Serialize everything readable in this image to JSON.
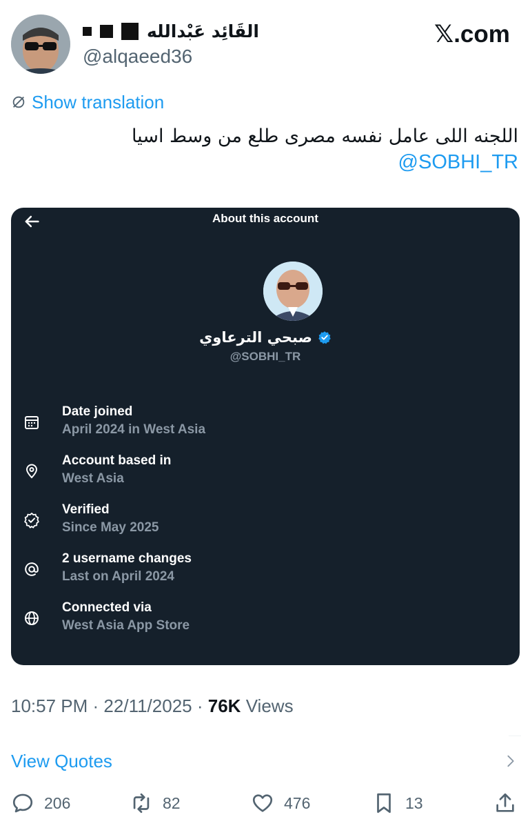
{
  "header": {
    "display_name": "القَائِد عَبْدالله",
    "handle": "@alqaeed36",
    "brand": "𝕏.com"
  },
  "tweet": {
    "show_translation": "Show translation",
    "text": "اللجنه اللى عامل نفسه مصرى طلع من وسط اسيا",
    "mention": "@SOBHI_TR"
  },
  "card": {
    "title": "About this account",
    "profile_name": "صبحي الترعاوي",
    "profile_handle": "@SOBHI_TR",
    "rows": [
      {
        "label": "Date joined",
        "value": "April 2024 in West Asia",
        "icon": "calendar-icon"
      },
      {
        "label": "Account based in",
        "value": "West Asia",
        "icon": "location-pin-icon"
      },
      {
        "label": "Verified",
        "value": "Since May 2025",
        "icon": "verified-badge-icon"
      },
      {
        "label": "2 username changes",
        "value": "Last on April 2024",
        "icon": "at-sign-icon"
      },
      {
        "label": "Connected via",
        "value": "West Asia App Store",
        "icon": "globe-icon"
      }
    ]
  },
  "meta": {
    "time": "10:57 PM",
    "date": "22/11/2025",
    "views_count": "76K",
    "views_label": "Views",
    "view_quotes": "View Quotes"
  },
  "actions": {
    "replies": "206",
    "reposts": "82",
    "likes": "476",
    "bookmarks": "13"
  },
  "colors": {
    "accent": "#1d9bf0",
    "card_bg": "#15202b",
    "muted": "#536471"
  }
}
